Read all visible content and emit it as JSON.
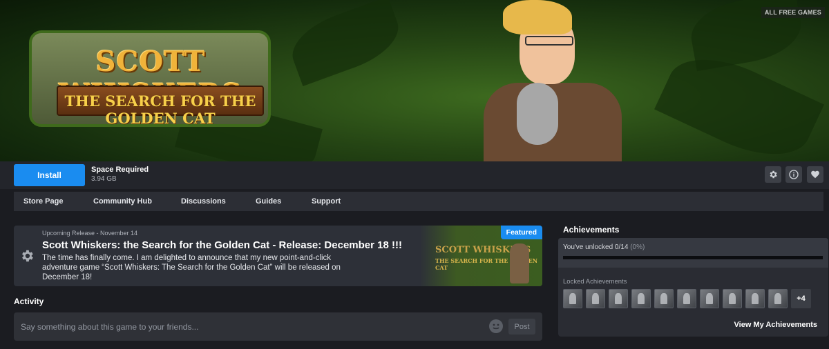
{
  "hero": {
    "corner_label": "ALL FREE GAMES",
    "logo_line1": "SCOTT WHISKERS",
    "logo_line2": "THE SEARCH FOR THE GOLDEN CAT"
  },
  "actionbar": {
    "install_label": "Install",
    "space_label": "Space Required",
    "space_value": "3.94 GB",
    "icons": [
      "gear-icon",
      "info-icon",
      "heart-icon"
    ]
  },
  "nav": {
    "items": [
      "Store Page",
      "Community Hub",
      "Discussions",
      "Guides",
      "Support"
    ]
  },
  "featured": {
    "date": "Upcoming Release - November 14",
    "title": "Scott Whiskers: the Search for the Golden Cat - Release: December 18 !!!",
    "body": "The time has finally come. I am delighted to announce that my new point-and-click adventure game “Scott Whiskers: The Search for the Golden Cat” will be released on December 18!",
    "badge": "Featured",
    "thumb_line1": "SCOTT WHISKERS",
    "thumb_line2": "THE SEARCH FOR THE GOLDEN CAT"
  },
  "activity": {
    "heading": "Activity",
    "placeholder": "Say something about this game to your friends...",
    "post_label": "Post"
  },
  "achievements": {
    "heading": "Achievements",
    "unlocked_text": "You've unlocked 0/14",
    "unlocked_pct": "(0%)",
    "progress_fraction": 0,
    "locked_label": "Locked Achievements",
    "locked_icon_count": 10,
    "more_label": "+4",
    "view_label": "View My Achievements"
  },
  "colors": {
    "accent": "#1a8cf0",
    "background": "#1b1c21"
  }
}
